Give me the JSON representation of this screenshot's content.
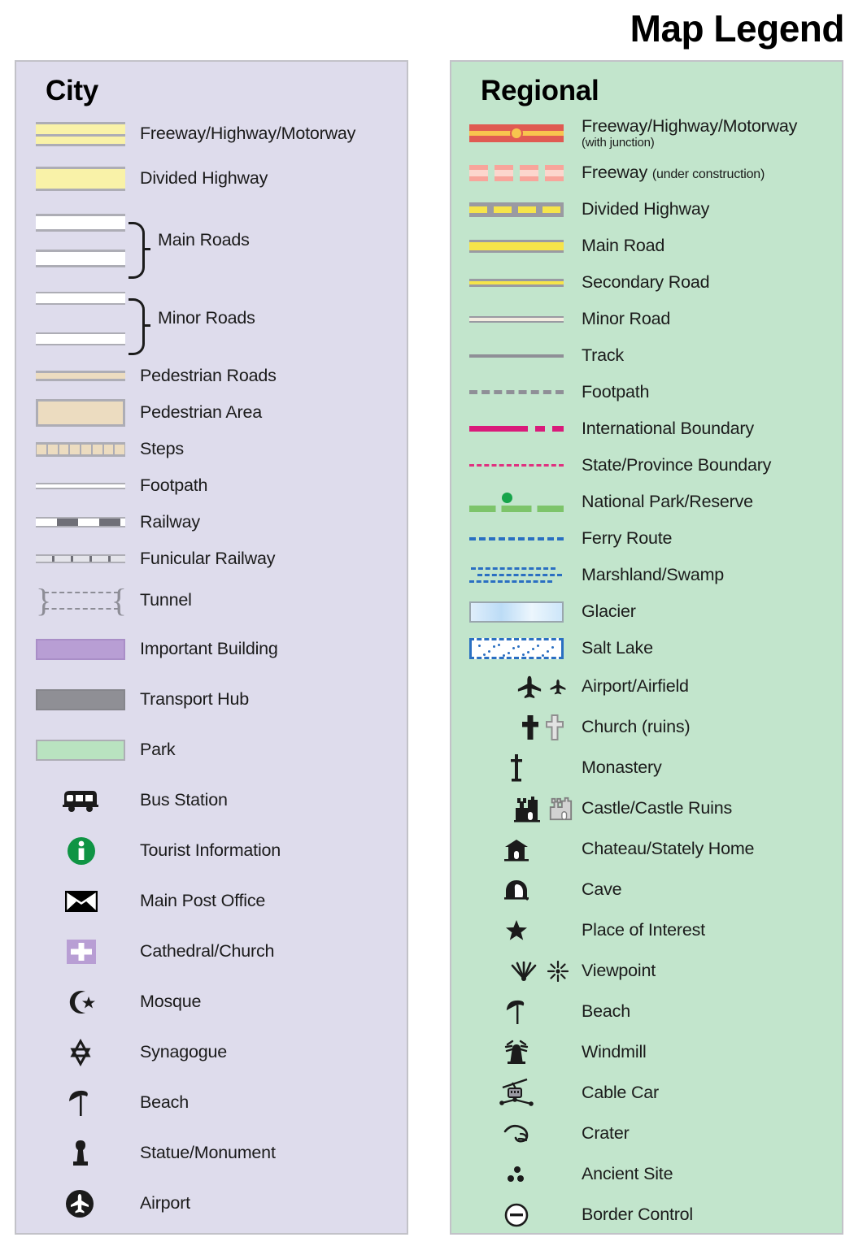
{
  "title": "Map Legend",
  "panels": {
    "city": {
      "heading": "City",
      "bg_color": "#dedcec",
      "items": [
        {
          "label": "Freeway/Highway/Motorway",
          "symbol": "city-freeway"
        },
        {
          "label": "Divided Highway",
          "symbol": "city-divided"
        },
        {
          "label": "Main Roads",
          "symbol": "city-main-roads-pair"
        },
        {
          "label": "Minor Roads",
          "symbol": "city-minor-roads-pair"
        },
        {
          "label": "Pedestrian Roads",
          "symbol": "city-pedestrian-road"
        },
        {
          "label": "Pedestrian Area",
          "symbol": "city-pedestrian-area"
        },
        {
          "label": "Steps",
          "symbol": "city-steps"
        },
        {
          "label": "Footpath",
          "symbol": "city-footpath"
        },
        {
          "label": "Railway",
          "symbol": "city-railway"
        },
        {
          "label": "Funicular Railway",
          "symbol": "city-funicular-railway"
        },
        {
          "label": "Tunnel",
          "symbol": "city-tunnel"
        },
        {
          "label": "Important Building",
          "symbol": "city-important-building"
        },
        {
          "label": "Transport Hub",
          "symbol": "city-transport-hub"
        },
        {
          "label": "Park",
          "symbol": "city-park"
        },
        {
          "label": "Bus Station",
          "symbol": "bus-icon"
        },
        {
          "label": "Tourist Information",
          "symbol": "info-icon"
        },
        {
          "label": "Main Post Office",
          "symbol": "envelope-icon"
        },
        {
          "label": "Cathedral/Church",
          "symbol": "cross-square-icon"
        },
        {
          "label": "Mosque",
          "symbol": "crescent-star-icon"
        },
        {
          "label": "Synagogue",
          "symbol": "star-of-david-icon"
        },
        {
          "label": "Beach",
          "symbol": "beach-umbrella-icon"
        },
        {
          "label": "Statue/Monument",
          "symbol": "statue-icon"
        },
        {
          "label": "Airport",
          "symbol": "airplane-circle-icon"
        }
      ]
    },
    "regional": {
      "heading": "Regional",
      "bg_color": "#c2e5cc",
      "items": [
        {
          "label": "Freeway/Highway/Motorway",
          "sublabel": "(with junction)",
          "symbol": "reg-freeway-junction"
        },
        {
          "label": "Freeway",
          "sublabel_inline": "(under construction)",
          "symbol": "reg-freeway-construction"
        },
        {
          "label": "Divided Highway",
          "symbol": "reg-divided-highway"
        },
        {
          "label": "Main Road",
          "symbol": "reg-main-road"
        },
        {
          "label": "Secondary Road",
          "symbol": "reg-secondary-road"
        },
        {
          "label": "Minor Road",
          "symbol": "reg-minor-road"
        },
        {
          "label": "Track",
          "symbol": "reg-track"
        },
        {
          "label": "Footpath",
          "symbol": "reg-footpath"
        },
        {
          "label": "International Boundary",
          "symbol": "reg-international-boundary"
        },
        {
          "label": "State/Province Boundary",
          "symbol": "reg-state-boundary"
        },
        {
          "label": "National Park/Reserve",
          "symbol": "reg-national-park"
        },
        {
          "label": "Ferry Route",
          "symbol": "reg-ferry-route"
        },
        {
          "label": "Marshland/Swamp",
          "symbol": "reg-marshland"
        },
        {
          "label": "Glacier",
          "symbol": "reg-glacier"
        },
        {
          "label": "Salt Lake",
          "symbol": "reg-salt-lake"
        },
        {
          "label": "Airport/Airfield",
          "symbol": "airplane-pair-icon"
        },
        {
          "label": "Church (ruins)",
          "symbol": "cross-pair-icon"
        },
        {
          "label": "Monastery",
          "symbol": "monastery-cross-icon"
        },
        {
          "label": "Castle/Castle Ruins",
          "symbol": "castle-pair-icon"
        },
        {
          "label": "Chateau/Stately Home",
          "symbol": "chateau-icon"
        },
        {
          "label": "Cave",
          "symbol": "cave-icon"
        },
        {
          "label": "Place of Interest",
          "symbol": "star-icon"
        },
        {
          "label": "Viewpoint",
          "symbol": "viewpoint-pair-icon"
        },
        {
          "label": "Beach",
          "symbol": "beach-umbrella-icon"
        },
        {
          "label": "Windmill",
          "symbol": "windmill-icon"
        },
        {
          "label": "Cable Car",
          "symbol": "cable-car-icon"
        },
        {
          "label": "Crater",
          "symbol": "crater-icon"
        },
        {
          "label": "Ancient Site",
          "symbol": "ancient-site-icon"
        },
        {
          "label": "Border Control",
          "symbol": "border-control-icon"
        }
      ]
    }
  },
  "colors": {
    "city_panel_bg": "#dedcec",
    "regional_panel_bg": "#c2e5cc",
    "panel_border": "#c2c2c8",
    "highway_yellow": "#f9f2a8",
    "road_grey": "#adadb5",
    "pedestrian_tan": "#ecdcc0",
    "important_building_purple": "#b89ed4",
    "transport_hub_grey": "#8f8f95",
    "park_green": "#b9e3c0",
    "tourist_info_green": "#0f9444",
    "freeway_red": "#e05a52",
    "freeway_orange": "#f8c44e",
    "under_construction_pink": "#f8a59b",
    "regional_yellow": "#f6e44a",
    "regional_grey": "#9a9aa2",
    "international_magenta": "#d91a7a",
    "state_pink": "#e0307f",
    "natpark_green": "#7dc46a",
    "ferry_blue": "#2a6fc2",
    "glacier_blue": "#bcdcf6",
    "text": "#1b1b1b"
  }
}
